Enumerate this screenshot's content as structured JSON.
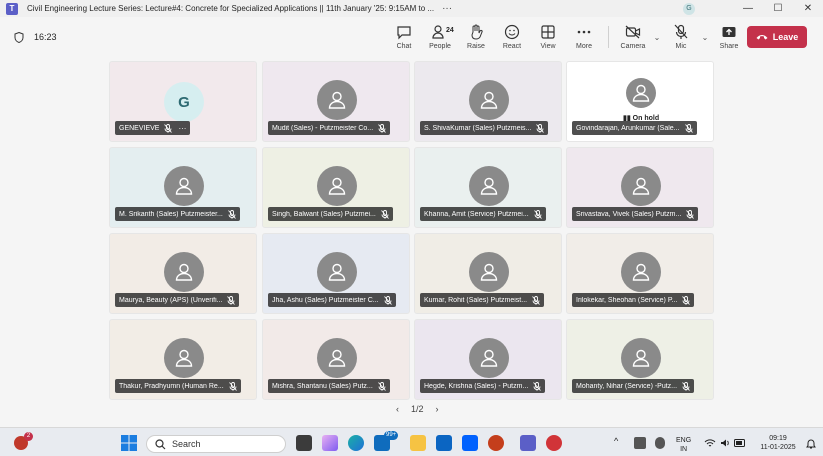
{
  "window": {
    "title": "Civil Engineering Lecture Series: Lecture#4: Concrete for Specialized Applications || 11th January '25: 9:15AM to ...",
    "more": "···",
    "avatar_letter": "G",
    "minimize": "—",
    "maximize": "☐",
    "close": "✕"
  },
  "meeting": {
    "elapsed": "16:23",
    "participant_count": "24",
    "tools": {
      "chat": "Chat",
      "people": "People",
      "raise": "Raise",
      "react": "React",
      "view": "View",
      "more": "More",
      "camera": "Camera",
      "mic": "Mic",
      "share": "Share"
    },
    "leave": "Leave"
  },
  "tiles": [
    {
      "name": "GENEVIEVE",
      "letter": "G",
      "type": "letter",
      "bg": "#f2e9ec"
    },
    {
      "name": "Mudit (Sales) - Putzmeister Co...",
      "type": "avatar",
      "bg": "#efe8ef"
    },
    {
      "name": "S. ShivaKumar (Sales) Putzmeis...",
      "type": "avatar",
      "bg": "#ece9ee"
    },
    {
      "name": "Govindarajan, Arunkumar (Sale...",
      "type": "onhold",
      "onhold": "On hold",
      "bg": "#ffffff"
    },
    {
      "name": "M. Srikanth (Sales) Putzmeister...",
      "type": "avatar",
      "bg": "#e4eef0"
    },
    {
      "name": "Singh, Balwant (Sales) Putzmei...",
      "type": "avatar",
      "bg": "#eef0e4"
    },
    {
      "name": "Khanna, Amit (Service) Putzmei...",
      "type": "avatar",
      "bg": "#eaf0ef"
    },
    {
      "name": "Srivastava, Vivek (Sales) Putzm...",
      "type": "avatar",
      "bg": "#efe8ee"
    },
    {
      "name": "Maurya, Beauty (APS) (Unverifi...",
      "type": "avatar",
      "bg": "#f2ece6"
    },
    {
      "name": "Jha, Ashu (Sales) Putzmeister C...",
      "type": "avatar",
      "bg": "#e6eaf2"
    },
    {
      "name": "Kumar, Rohit (Sales) Putzmeist...",
      "type": "avatar",
      "bg": "#f0ede6"
    },
    {
      "name": "Irilokekar, Sheohan (Service) P...",
      "type": "avatar",
      "bg": "#f1ede8"
    },
    {
      "name": "Thakur, Pradhyumn (Human Re...",
      "type": "avatar",
      "bg": "#f2ede6"
    },
    {
      "name": "Mishra, Shantanu (Sales) Putz...",
      "type": "avatar",
      "bg": "#f2eae8"
    },
    {
      "name": "Hegde, Krishna (Sales) - Putzm...",
      "type": "avatar",
      "bg": "#ebe6ef"
    },
    {
      "name": "Mohanty, Nihar (Service) -Putz...",
      "type": "avatar",
      "bg": "#eef0e6"
    }
  ],
  "pagination": {
    "label": "1/2"
  },
  "taskbar": {
    "search_placeholder": "Search",
    "notification_badge": "2",
    "mail_badge": "99+",
    "language": "ENG",
    "region": "IN",
    "time": "09:19",
    "date": "11-01-2025"
  },
  "colors": {
    "accent": "#5b5fc7",
    "leave": "#c4314b",
    "avatar": "#8a8a8a"
  }
}
